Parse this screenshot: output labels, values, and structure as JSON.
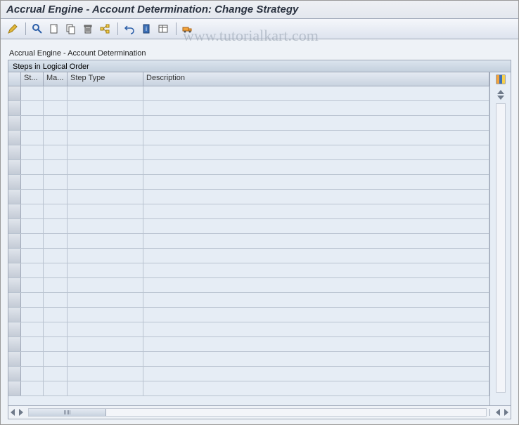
{
  "title": "Accrual Engine - Account Determination: Change Strategy",
  "watermark": "www.tutorialkart.com",
  "toolbar": {
    "icons": [
      "edit-icon",
      "find-icon",
      "new-icon",
      "copy-icon",
      "delete-icon",
      "where-used-icon",
      "undo-icon",
      "info-icon",
      "layout-icon",
      "transport-icon"
    ]
  },
  "workspace_label": "Accrual Engine - Account Determination",
  "panel_title": "Steps in Logical Order",
  "columns": {
    "step": "St...",
    "manual": "Ma...",
    "step_type": "Step Type",
    "description": "Description"
  },
  "rows": [
    {
      "st": "",
      "ma": "",
      "ty": "",
      "de": ""
    },
    {
      "st": "",
      "ma": "",
      "ty": "",
      "de": ""
    },
    {
      "st": "",
      "ma": "",
      "ty": "",
      "de": ""
    },
    {
      "st": "",
      "ma": "",
      "ty": "",
      "de": ""
    },
    {
      "st": "",
      "ma": "",
      "ty": "",
      "de": ""
    },
    {
      "st": "",
      "ma": "",
      "ty": "",
      "de": ""
    },
    {
      "st": "",
      "ma": "",
      "ty": "",
      "de": ""
    },
    {
      "st": "",
      "ma": "",
      "ty": "",
      "de": ""
    },
    {
      "st": "",
      "ma": "",
      "ty": "",
      "de": ""
    },
    {
      "st": "",
      "ma": "",
      "ty": "",
      "de": ""
    },
    {
      "st": "",
      "ma": "",
      "ty": "",
      "de": ""
    },
    {
      "st": "",
      "ma": "",
      "ty": "",
      "de": ""
    },
    {
      "st": "",
      "ma": "",
      "ty": "",
      "de": ""
    },
    {
      "st": "",
      "ma": "",
      "ty": "",
      "de": ""
    },
    {
      "st": "",
      "ma": "",
      "ty": "",
      "de": ""
    },
    {
      "st": "",
      "ma": "",
      "ty": "",
      "de": ""
    },
    {
      "st": "",
      "ma": "",
      "ty": "",
      "de": ""
    },
    {
      "st": "",
      "ma": "",
      "ty": "",
      "de": ""
    },
    {
      "st": "",
      "ma": "",
      "ty": "",
      "de": ""
    },
    {
      "st": "",
      "ma": "",
      "ty": "",
      "de": ""
    },
    {
      "st": "",
      "ma": "",
      "ty": "",
      "de": ""
    }
  ]
}
